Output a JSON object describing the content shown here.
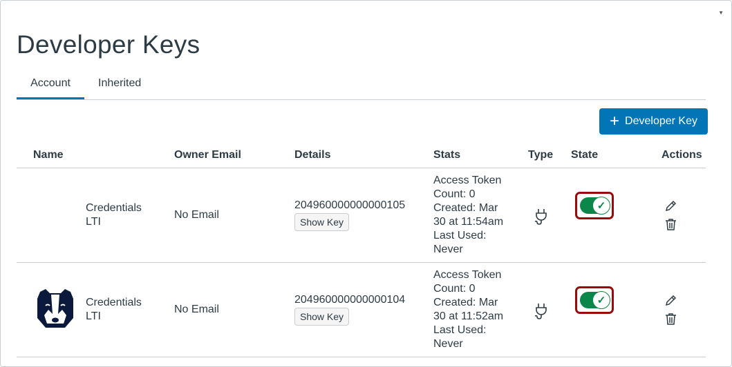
{
  "page_title": "Developer Keys",
  "tabs": [
    {
      "label": "Account",
      "active": true
    },
    {
      "label": "Inherited",
      "active": false
    }
  ],
  "add_button": {
    "icon": "plus-icon",
    "label": "Developer Key"
  },
  "columns": [
    "Name",
    "Owner Email",
    "Details",
    "Stats",
    "Type",
    "State",
    "Actions"
  ],
  "rows": [
    {
      "logo": null,
      "name": [
        "Credentials",
        "LTI"
      ],
      "owner_email": "No Email",
      "key_id": "204960000000000105",
      "show_key": "Show Key",
      "stats": [
        "Access Token",
        "Count: 0",
        "Created: Mar",
        "30 at 11:54am",
        "Last Used:",
        "Never"
      ],
      "type_icon": "plug-icon",
      "state_on": true
    },
    {
      "logo": "badger-logo",
      "name": [
        "Credentials",
        "LTI"
      ],
      "owner_email": "No Email",
      "key_id": "204960000000000104",
      "show_key": "Show Key",
      "stats": [
        "Access Token",
        "Count: 0",
        "Created: Mar",
        "30 at 11:52am",
        "Last Used:",
        "Never"
      ],
      "type_icon": "plug-icon",
      "state_on": true
    }
  ],
  "colors": {
    "accent": "#0374B5",
    "toggle_on": "#0B874B",
    "highlight": "#9B0A0A"
  }
}
